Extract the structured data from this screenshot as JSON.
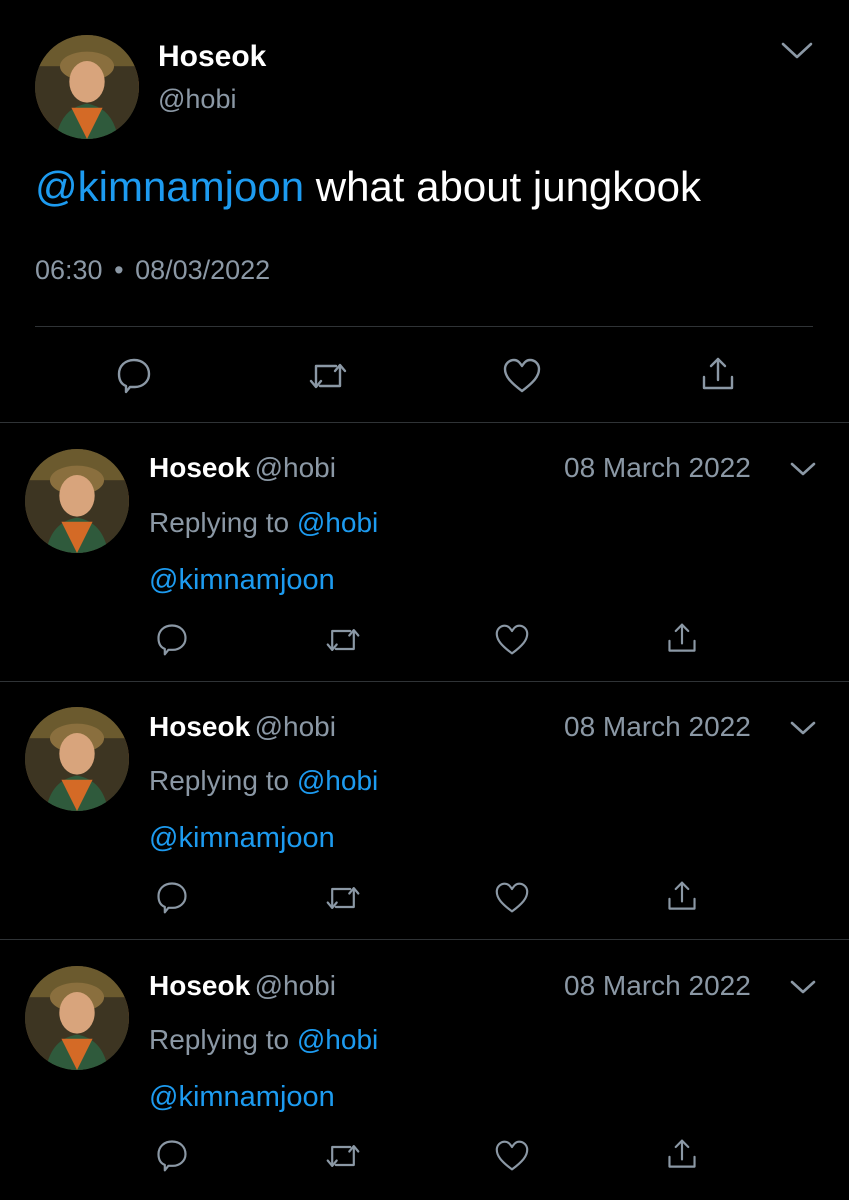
{
  "main_tweet": {
    "display_name": "Hoseok",
    "handle": "@hobi",
    "mention": "@kimnamjoon",
    "text": " what about jungkook",
    "time": "06:30",
    "separator": "•",
    "date": "08/03/2022",
    "avatar_icon": "profile-photo",
    "menu_icon": "chevron-down-icon"
  },
  "actions": {
    "reply_icon": "reply-icon",
    "retweet_icon": "retweet-icon",
    "like_icon": "heart-icon",
    "share_icon": "share-icon"
  },
  "replies": [
    {
      "display_name": "Hoseok",
      "handle": "@hobi",
      "date": "08 March 2022",
      "replying_prefix": "Replying to ",
      "replying_to": "@hobi",
      "text": "@kimnamjoon"
    },
    {
      "display_name": "Hoseok",
      "handle": "@hobi",
      "date": "08 March 2022",
      "replying_prefix": "Replying to ",
      "replying_to": "@hobi",
      "text": "@kimnamjoon"
    },
    {
      "display_name": "Hoseok",
      "handle": "@hobi",
      "date": "08 March 2022",
      "replying_prefix": "Replying to ",
      "replying_to": "@hobi",
      "text": "@kimnamjoon"
    }
  ],
  "colors": {
    "background": "#000000",
    "link": "#1d9bf0",
    "muted": "#8b98a5",
    "divider": "#2f3336"
  }
}
